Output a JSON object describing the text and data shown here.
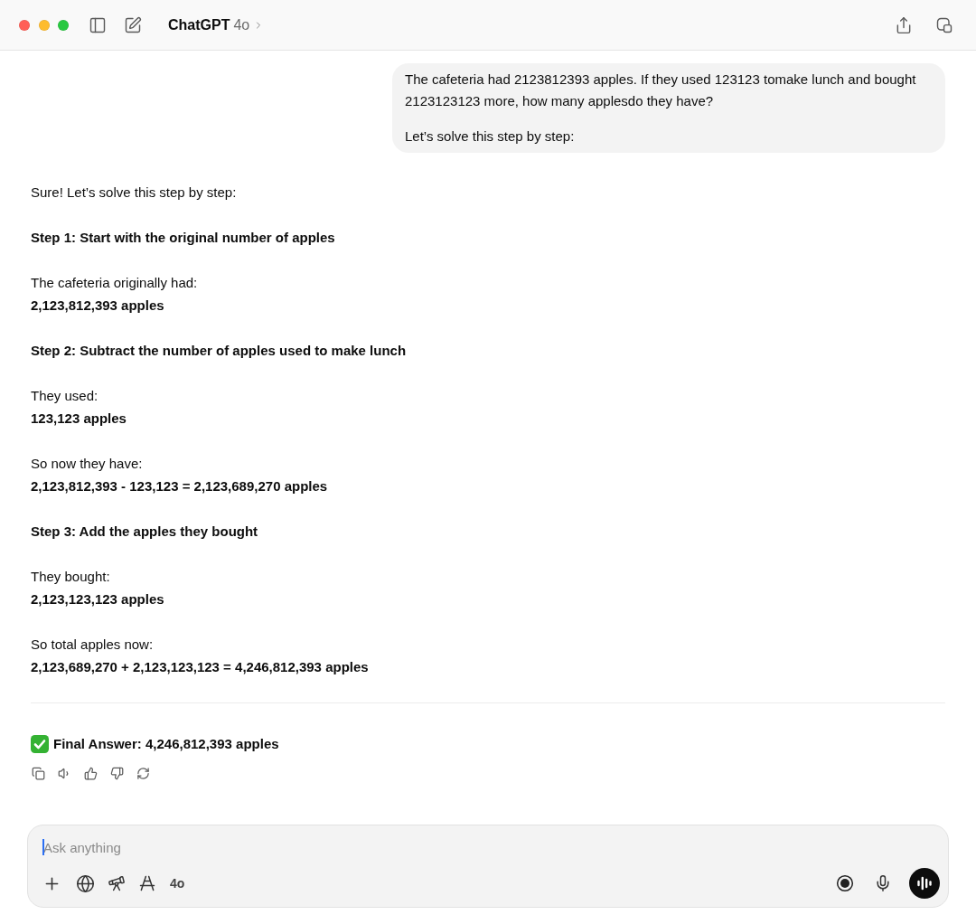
{
  "window": {
    "title": "ChatGPT",
    "model": "4o"
  },
  "user_message": {
    "paragraphs": [
      "The cafeteria had 2123812393 apples. If they used 123123 tomake lunch and bought 2123123123 more, how many applesdo they have?",
      "Let’s solve this step by step:"
    ]
  },
  "assistant_message": {
    "blocks": [
      {
        "kind": "text",
        "text": "Sure! Let’s solve this step by step:"
      },
      {
        "kind": "heading",
        "text": "Step 1: Start with the original number of apples"
      },
      {
        "kind": "text",
        "text": "The cafeteria originally had:\n**2,123,812,393 apples**"
      },
      {
        "kind": "heading",
        "text": "Step 2: Subtract the number of apples used to make lunch"
      },
      {
        "kind": "text",
        "text": "They used:\n**123,123 apples**"
      },
      {
        "kind": "text",
        "text": "So now they have:\n**2,123,812,393 - 123,123 = 2,123,689,270 apples**"
      },
      {
        "kind": "heading",
        "text": "Step 3: Add the apples they bought"
      },
      {
        "kind": "text",
        "text": "They bought:\n**2,123,123,123 apples**"
      },
      {
        "kind": "text",
        "text": "So total apples now:\n**2,123,689,270 + 2,123,123,123 = 4,246,812,393 apples**"
      },
      {
        "kind": "rule"
      },
      {
        "kind": "answer",
        "text": "Final Answer: 4,246,812,393 apples"
      }
    ]
  },
  "composer": {
    "placeholder": "Ask anything",
    "focused": true,
    "model": "4o"
  }
}
